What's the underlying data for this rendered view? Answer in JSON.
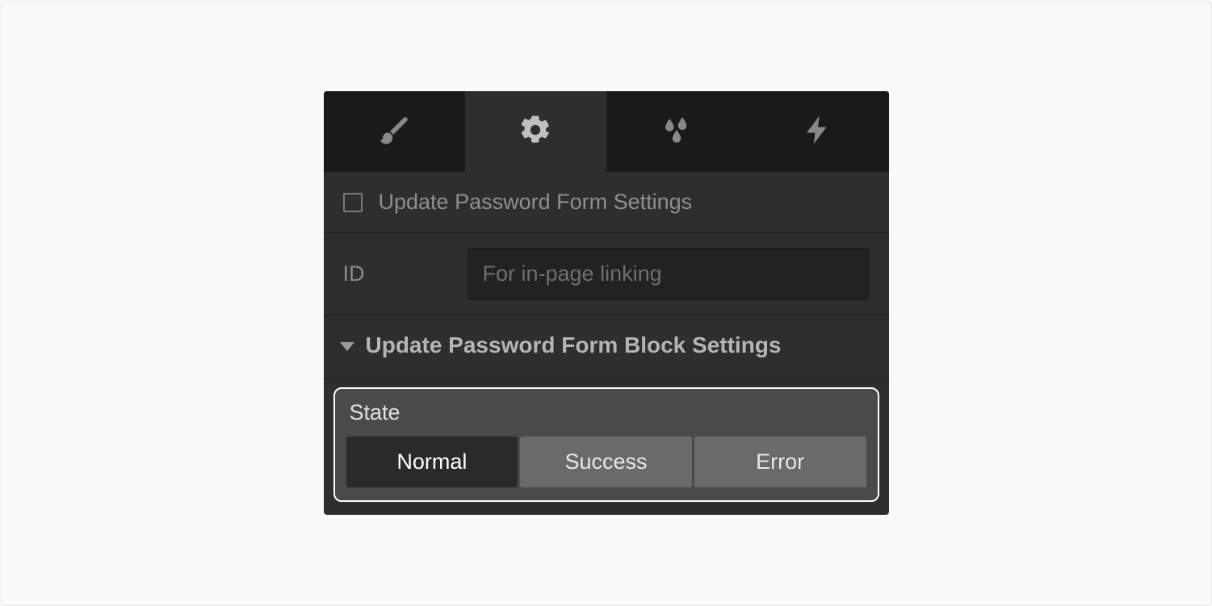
{
  "tabs": {
    "style": "style-tab",
    "settings": "settings-tab",
    "effects": "effects-tab",
    "interactions": "interactions-tab"
  },
  "title": {
    "label": "Update Password Form Settings"
  },
  "id_field": {
    "label": "ID",
    "placeholder": "For in-page linking",
    "value": ""
  },
  "section": {
    "title": "Update Password Form Block Settings"
  },
  "state": {
    "label": "State",
    "options": [
      "Normal",
      "Success",
      "Error"
    ],
    "selected": "Normal"
  }
}
